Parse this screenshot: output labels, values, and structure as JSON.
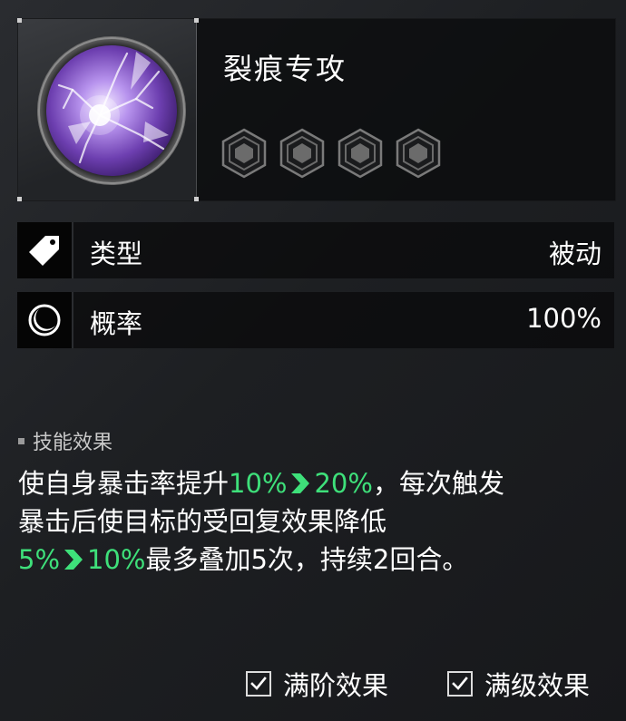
{
  "skill": {
    "name": "裂痕专攻",
    "icon": "purple-crack-orb-icon",
    "rank_gems": [
      {
        "icon": "hexagon-rank-icon",
        "filled": false
      },
      {
        "icon": "hexagon-rank-icon",
        "filled": false
      },
      {
        "icon": "hexagon-rank-icon",
        "filled": false
      },
      {
        "icon": "hexagon-rank-icon",
        "filled": false
      }
    ]
  },
  "attributes": {
    "type": {
      "icon": "tag-icon",
      "label": "类型",
      "value": "被动"
    },
    "probability": {
      "icon": "moon-icon",
      "label": "概率",
      "value": "100%"
    }
  },
  "effect": {
    "heading": "技能效果",
    "line1_before": "使自身暴击率提升",
    "line1_from": "10%",
    "line1_to": "20%",
    "line1_after": "，每次触发",
    "line2": "暴击后使目标的受回复效果降低",
    "line3_from": "5%",
    "line3_to": "10%",
    "line3_after": "最多叠加5次，持续2回合。"
  },
  "toggles": {
    "max_rank": {
      "label": "满阶效果",
      "checked": true
    },
    "max_level": {
      "label": "满级效果",
      "checked": true
    }
  },
  "colors": {
    "highlight": "#3ee07a",
    "panel": "#0a0b0d",
    "orb_purple": "#a07be0"
  }
}
